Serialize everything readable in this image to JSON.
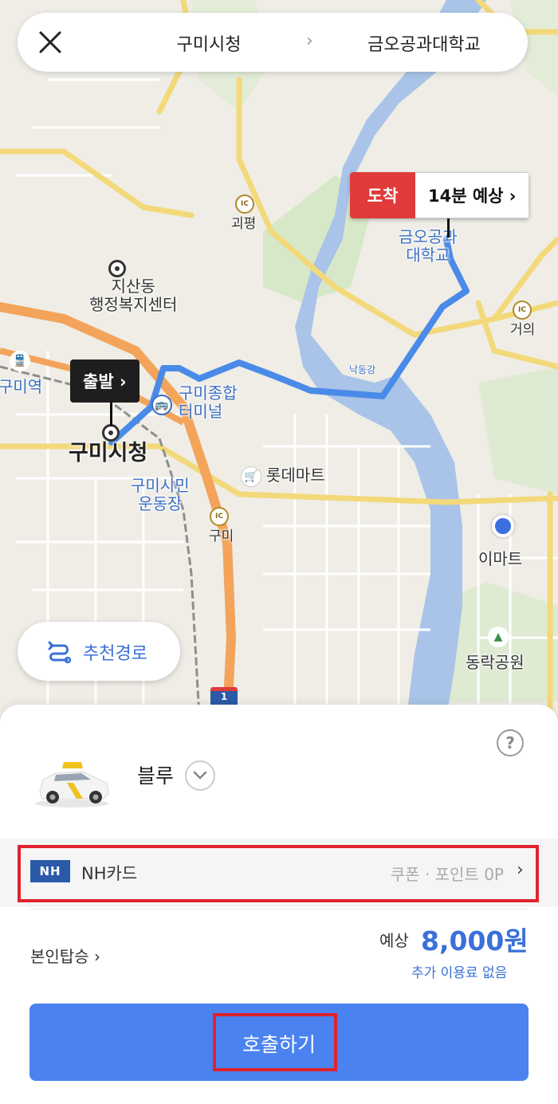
{
  "route": {
    "origin": "구미시청",
    "separator": "›",
    "destination": "금오공과대학교"
  },
  "markers": {
    "arrive_tag": "도착",
    "arrive_eta": "14분 예상 ›",
    "depart": "출발 ›"
  },
  "map_labels": {
    "jisan": "지산동\n행정복지센터",
    "gumi_station": "구미역",
    "terminal": "구미종합\n터미널",
    "city_hall": "구미시청",
    "stadium": "구미시민\n운동장",
    "lotte_mart": "롯데마트",
    "emart": "이마트",
    "park": "동락공원",
    "kumoh": "금오공과\n대학교",
    "river": "낙동강",
    "ic_gwepyeong": "괴평",
    "ic_geoui": "거의",
    "ic_gumi": "구미",
    "ic_text": "IC",
    "route_shield": "1"
  },
  "recommend_route": {
    "label": "추천경로"
  },
  "sheet": {
    "help": "?",
    "car_type": "블루",
    "payment": {
      "logo": "NH",
      "card_name": "NH카드",
      "coupon_point": "쿠폰 · 포인트 0P",
      "arrow": "›"
    },
    "self_ride": "본인탑승 ›",
    "fare_prefix": "예상",
    "fare_amount": "8,000원",
    "fare_note": "추가 이용료 없음",
    "call_button": "호출하기"
  },
  "colors": {
    "accent_blue": "#4a82f0",
    "route_blue": "#4a8ae8",
    "arrive_red": "#e03a3a",
    "highlight_red": "#e0222e",
    "nh_blue": "#2b5aa8"
  }
}
